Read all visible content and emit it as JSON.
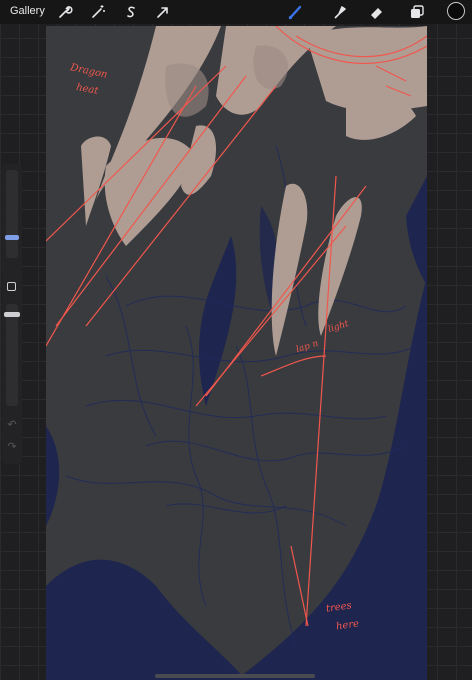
{
  "toolbar": {
    "gallery_label": "Gallery",
    "actions": [
      {
        "name": "wrench-icon"
      },
      {
        "name": "magic-wand-icon"
      },
      {
        "name": "selection-s-icon"
      },
      {
        "name": "transform-arrow-icon"
      }
    ],
    "tools": [
      {
        "name": "brush-icon",
        "active": true
      },
      {
        "name": "smudge-icon",
        "active": false
      },
      {
        "name": "eraser-icon",
        "active": false
      },
      {
        "name": "layers-icon",
        "active": false
      }
    ],
    "active_color": "#0b0b0c",
    "active_tool_color": "#3b74e8"
  },
  "sidebar": {
    "brush_size_level": 0.4,
    "opacity_level": 0.6,
    "undo_icon": "undo-icon",
    "redo_icon": "redo-icon"
  },
  "canvas": {
    "background": "#3a3b3f",
    "annotations": {
      "top_left": "Dragon",
      "top_left_line2": "heat",
      "middle_right": "light",
      "middle_right_prefix": "lap n",
      "bottom_right": "trees",
      "bottom_right_line2": "here"
    },
    "colors": {
      "beige": "#b9a69c",
      "navy": "#1c2450",
      "red": "#f0574d"
    }
  }
}
